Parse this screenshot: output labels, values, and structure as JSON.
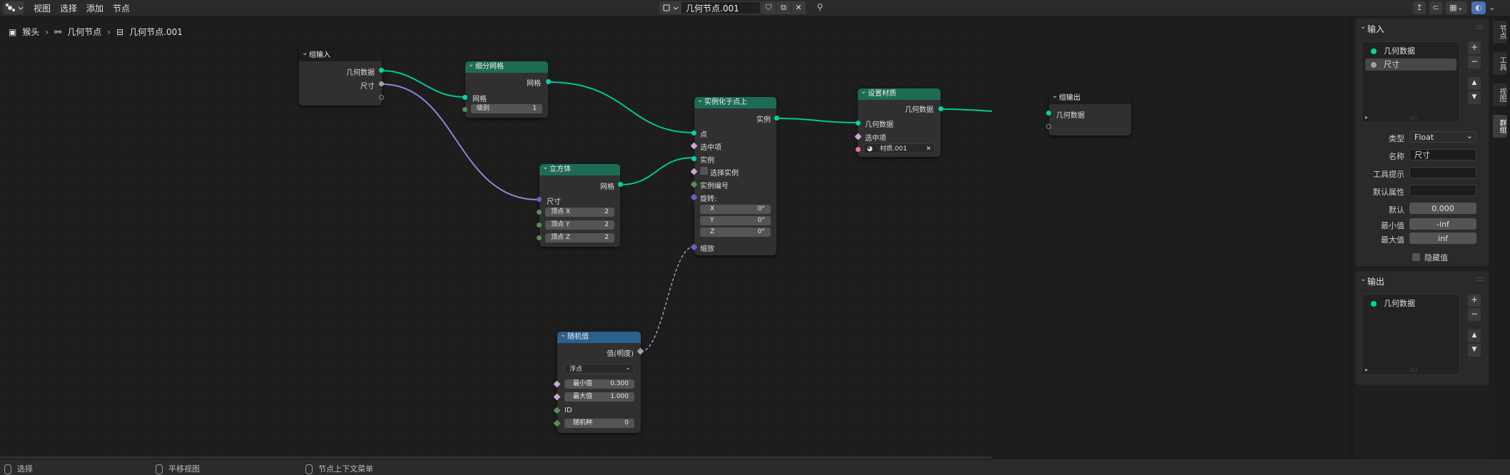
{
  "menu": {
    "items": [
      "视图",
      "选择",
      "添加",
      "节点"
    ]
  },
  "header": {
    "node_tree_name": "几何节点.001"
  },
  "breadcrumb": {
    "object": "猴头",
    "modifier": "几何节点",
    "tree": "几何节点.001"
  },
  "nodes": {
    "group_input": {
      "title": "组输入",
      "out_geometry": "几何数据",
      "out_size": "尺寸"
    },
    "subdivide": {
      "title": "细分网格",
      "out_mesh": "网格",
      "in_mesh": "网格",
      "level_label": "级别",
      "level_value": "1"
    },
    "cube": {
      "title": "立方体",
      "out_mesh": "网格",
      "in_size": "尺寸",
      "vx_label": "顶点 X",
      "vx_value": "2",
      "vy_label": "顶点 Y",
      "vy_value": "2",
      "vz_label": "顶点 Z",
      "vz_value": "2"
    },
    "instance_on_points": {
      "title": "实例化于点上",
      "out_instances": "实例",
      "in_points": "点",
      "in_selection": "选中项",
      "in_instance": "实例",
      "in_pick_instance": "选择实例",
      "in_instance_index": "实例编号",
      "in_rotation": "旋转:",
      "rot_x_label": "X",
      "rot_x_value": "0°",
      "rot_y_label": "Y",
      "rot_y_value": "0°",
      "rot_z_label": "Z",
      "rot_z_value": "0°",
      "in_scale": "缩放"
    },
    "set_material": {
      "title": "设置材质",
      "out_geometry": "几何数据",
      "in_geometry": "几何数据",
      "in_selection": "选中项",
      "material_name": "材质.001"
    },
    "group_output": {
      "title": "组输出",
      "in_geometry": "几何数据"
    },
    "random_value": {
      "title": "随机值",
      "out_value": "值(明度)",
      "type_option": "浮点",
      "min_label": "最小值",
      "min_value": "0.300",
      "max_label": "最大值",
      "max_value": "1.000",
      "id_label": "ID",
      "seed_label": "随机种",
      "seed_value": "0"
    }
  },
  "sidebar": {
    "inputs_title": "输入",
    "inputs": [
      {
        "label": "几何数据",
        "color": "#00d6a3"
      },
      {
        "label": "尺寸",
        "color": "#a1a1a1"
      }
    ],
    "props": {
      "type_label": "类型",
      "type_value": "Float",
      "name_label": "名称",
      "name_value": "尺寸",
      "tooltip_label": "工具提示",
      "tooltip_value": "",
      "default_attr_label": "默认属性",
      "default_attr_value": "",
      "default_label": "默认",
      "default_value": "0.000",
      "min_label": "最小值",
      "min_value": "-inf",
      "max_label": "最大值",
      "max_value": "inf",
      "hide_value_label": "隐藏值"
    },
    "outputs_title": "输出",
    "outputs": [
      {
        "label": "几何数据",
        "color": "#00d6a3"
      }
    ]
  },
  "tabs": [
    "节点",
    "工具",
    "视图",
    "群组"
  ],
  "status": {
    "left": "选择",
    "middle": "平移视图",
    "right": "节点上下文菜单"
  }
}
